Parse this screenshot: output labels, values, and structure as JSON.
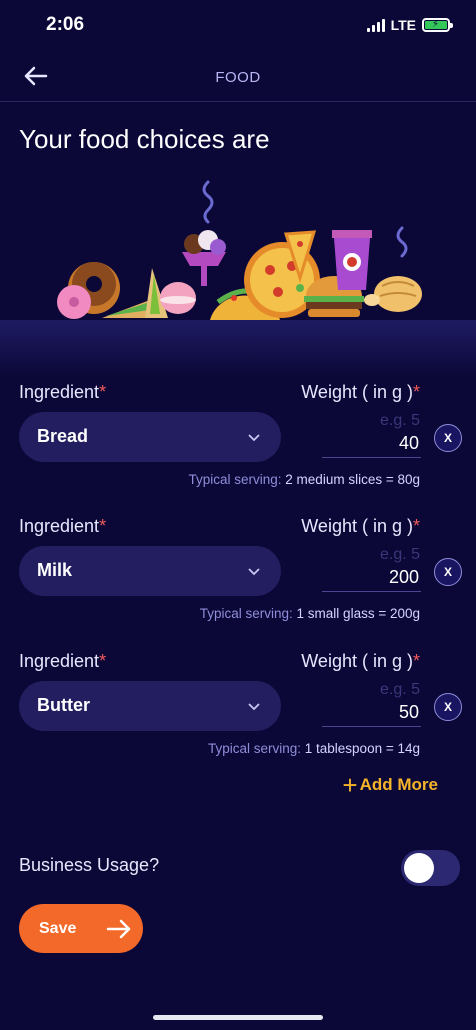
{
  "status_bar": {
    "time": "2:06",
    "network": "LTE",
    "battery_level": 0.9
  },
  "header": {
    "title": "FOOD",
    "back_icon": "arrow-left-icon"
  },
  "page_title": "Your food choices are",
  "form": {
    "ingredient_label": "Ingredient",
    "weight_label": "Weight ( in g )",
    "required_mark": "*",
    "weight_placeholder": "e.g. 5",
    "remove_label": "X",
    "rows": [
      {
        "ingredient": "Bread",
        "weight": "40",
        "hint_prefix": "Typical serving:",
        "hint_value": "2 medium slices = 80g"
      },
      {
        "ingredient": "Milk",
        "weight": "200",
        "hint_prefix": "Typical serving:",
        "hint_value": "1 small glass = 200g"
      },
      {
        "ingredient": "Butter",
        "weight": "50",
        "hint_prefix": "Typical serving:",
        "hint_value": "1 tablespoon = 14g"
      }
    ],
    "add_more": "Add More",
    "business_label": "Business Usage?",
    "business_on": false,
    "save_label": "Save"
  },
  "colors": {
    "background": "#0b0838",
    "accent": "#f2692a",
    "link": "#f4b329",
    "required": "#f05a5a"
  }
}
